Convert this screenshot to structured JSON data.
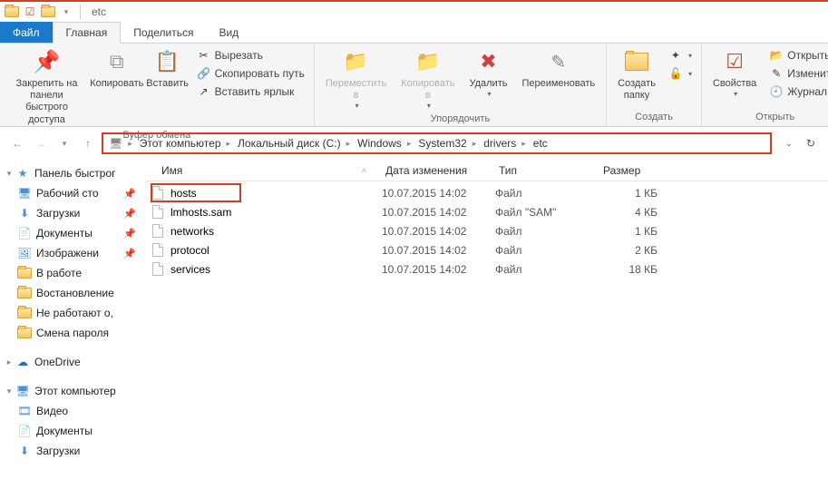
{
  "titlebar": {
    "title": "etc"
  },
  "tabs": {
    "file": "Файл",
    "home": "Главная",
    "share": "Поделиться",
    "view": "Вид"
  },
  "ribbon": {
    "clipboard": {
      "label": "Буфер обмена",
      "pin": "Закрепить на панели\nбыстрого доступа",
      "copy": "Копировать",
      "paste": "Вставить",
      "cut": "Вырезать",
      "copy_path": "Скопировать путь",
      "paste_shortcut": "Вставить ярлык"
    },
    "organize": {
      "label": "Упорядочить",
      "move_to": "Переместить\nв",
      "copy_to": "Копировать\nв",
      "delete": "Удалить",
      "rename": "Переименовать"
    },
    "new": {
      "label": "Создать",
      "new_folder": "Создать\nпапку"
    },
    "open": {
      "label": "Открыть",
      "properties": "Свойства",
      "open": "Открыть",
      "edit": "Изменить",
      "history": "Журнал"
    }
  },
  "breadcrumbs": [
    "Этот компьютер",
    "Локальный диск (C:)",
    "Windows",
    "System32",
    "drivers",
    "etc"
  ],
  "columns": {
    "name": "Имя",
    "date": "Дата изменения",
    "type": "Тип",
    "size": "Размер"
  },
  "files": [
    {
      "name": "hosts",
      "date": "10.07.2015 14:02",
      "type": "Файл",
      "size": "1 КБ"
    },
    {
      "name": "lmhosts.sam",
      "date": "10.07.2015 14:02",
      "type": "Файл \"SAM\"",
      "size": "4 КБ"
    },
    {
      "name": "networks",
      "date": "10.07.2015 14:02",
      "type": "Файл",
      "size": "1 КБ"
    },
    {
      "name": "protocol",
      "date": "10.07.2015 14:02",
      "type": "Файл",
      "size": "2 КБ"
    },
    {
      "name": "services",
      "date": "10.07.2015 14:02",
      "type": "Файл",
      "size": "18 КБ"
    }
  ],
  "nav": {
    "quick": "Панель быстрог",
    "quick_items": [
      {
        "label": "Рабочий сто",
        "pin": true,
        "ico": "desktop"
      },
      {
        "label": "Загрузки",
        "pin": true,
        "ico": "downloads"
      },
      {
        "label": "Документы",
        "pin": true,
        "ico": "documents"
      },
      {
        "label": "Изображени",
        "pin": true,
        "ico": "pictures"
      },
      {
        "label": "В работе",
        "pin": false,
        "ico": "folder"
      },
      {
        "label": "Востановление",
        "pin": false,
        "ico": "folder"
      },
      {
        "label": "Не работают о,",
        "pin": false,
        "ico": "folder"
      },
      {
        "label": "Смена пароля",
        "pin": false,
        "ico": "folder"
      }
    ],
    "onedrive": "OneDrive",
    "this_pc": "Этот компьютер",
    "pc_items": [
      {
        "label": "Видео",
        "ico": "video"
      },
      {
        "label": "Документы",
        "ico": "documents"
      },
      {
        "label": "Загрузки",
        "ico": "downloads"
      }
    ]
  }
}
